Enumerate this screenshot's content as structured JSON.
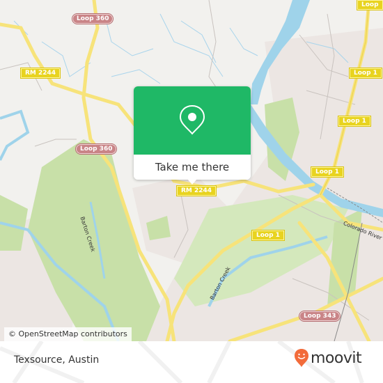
{
  "popup": {
    "action_label": "Take me there",
    "icon": "map-pin-icon",
    "color": "#1fb866"
  },
  "map": {
    "attribution": "© OpenStreetMap contributors",
    "road_shields": [
      {
        "label": "Loop 360",
        "style": "red"
      },
      {
        "label": "RM 2244",
        "style": "yellow"
      },
      {
        "label": "Loop 360",
        "style": "red"
      },
      {
        "label": "RM 2244",
        "style": "yellow"
      },
      {
        "label": "Loop",
        "style": "yellow"
      },
      {
        "label": "Loop 1",
        "style": "yellow"
      },
      {
        "label": "Loop 1",
        "style": "yellow"
      },
      {
        "label": "Loop 1",
        "style": "yellow"
      },
      {
        "label": "Loop 1",
        "style": "yellow"
      },
      {
        "label": "Loop 343",
        "style": "red"
      }
    ],
    "labels": {
      "barton_creek_west": "Barton Creek",
      "barton_creek_east": "Barton Creek",
      "colorado_river": "Colorado River"
    },
    "colors": {
      "land": "#f2f1ee",
      "park": "#c8e0a8",
      "water": "#9fd3ea",
      "highway": "#f7e37a",
      "urban": "#ece6e3"
    }
  },
  "footer": {
    "place_name": "Texsource, Austin",
    "brand": "moovit",
    "brand_icon": "moovit-logo-icon",
    "brand_color": "#f26b3a"
  }
}
